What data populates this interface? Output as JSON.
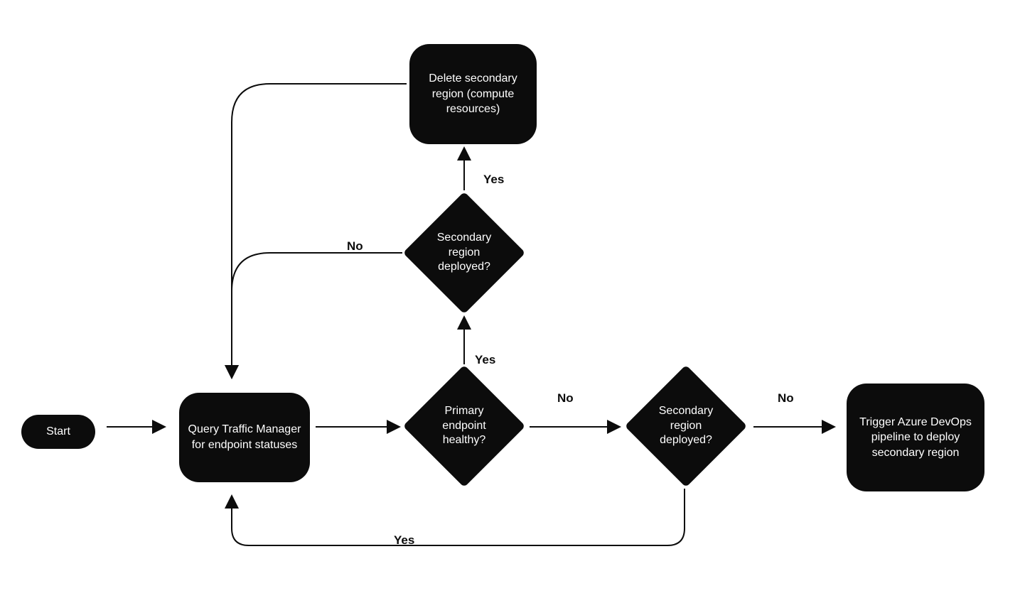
{
  "nodes": {
    "start": {
      "label": "Start"
    },
    "query": {
      "label": "Query Traffic Manager for endpoint statuses"
    },
    "primary_healthy": {
      "label": "Primary endpoint healthy?"
    },
    "secondary_deployed_top": {
      "label": "Secondary region deployed?"
    },
    "secondary_deployed_right": {
      "label": "Secondary region deployed?"
    },
    "delete_secondary": {
      "label": "Delete secondary region (compute resources)"
    },
    "trigger_pipeline": {
      "label": "Trigger Azure DevOps pipeline to deploy secondary region"
    }
  },
  "edges": {
    "primary_yes": {
      "label": "Yes"
    },
    "primary_no": {
      "label": "No"
    },
    "secondary_top_yes": {
      "label": "Yes"
    },
    "secondary_top_no": {
      "label": "No"
    },
    "secondary_right_no": {
      "label": "No"
    },
    "secondary_right_yes": {
      "label": "Yes"
    }
  }
}
